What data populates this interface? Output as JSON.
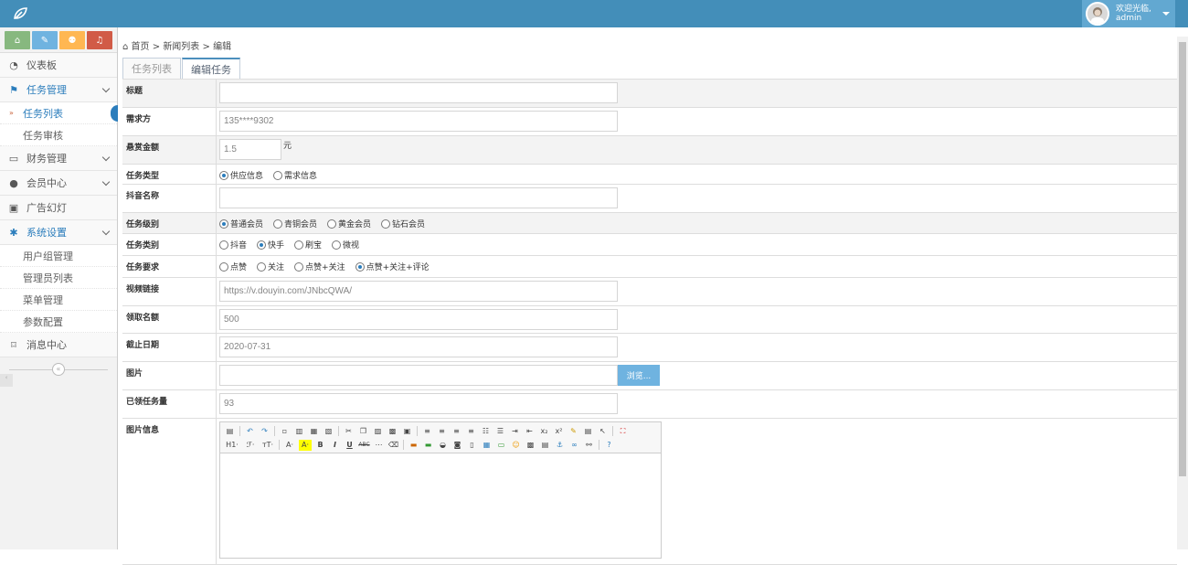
{
  "header": {
    "welcome": "欢迎光临,",
    "username": "admin"
  },
  "sidebar": {
    "items": [
      {
        "label": "仪表板",
        "icon": "dashboard-icon",
        "glyph": "◔"
      },
      {
        "label": "任务管理",
        "icon": "flag-icon",
        "glyph": "⚑",
        "open": true,
        "children": [
          "任务列表",
          "任务审核"
        ]
      },
      {
        "label": "财务管理",
        "icon": "inbox-icon",
        "glyph": "▭"
      },
      {
        "label": "会员中心",
        "icon": "user-icon",
        "glyph": "●"
      },
      {
        "label": "广告幻灯",
        "icon": "picture-icon",
        "glyph": "▣"
      },
      {
        "label": "系统设置",
        "icon": "gear-icon",
        "glyph": "✱",
        "open": true,
        "children": [
          "用户组管理",
          "管理员列表",
          "菜单管理",
          "参数配置"
        ]
      },
      {
        "label": "消息中心",
        "icon": "bookmark-icon",
        "glyph": "⌑"
      }
    ],
    "collapse": "«"
  },
  "breadcrumb": {
    "home": "首页",
    "list": "新闻列表",
    "current": "编辑",
    "sep": ">"
  },
  "tabs": {
    "list": "任务列表",
    "edit": "编辑任务"
  },
  "form": {
    "title_label": "标题",
    "title_value": "",
    "demand_label": "需求方",
    "demand_value": "135****9302",
    "reward_label": "悬赏金额",
    "reward_value": "1.5",
    "reward_unit": "元",
    "type_label": "任务类型",
    "type_options": [
      "供应信息",
      "需求信息"
    ],
    "douyin_label": "抖音名称",
    "douyin_value": "",
    "level_label": "任务级别",
    "level_options": [
      "普通会员",
      "青铜会员",
      "黄金会员",
      "钻石会员"
    ],
    "category_label": "任务类别",
    "category_options": [
      "抖音",
      "快手",
      "刷宝",
      "微视"
    ],
    "require_label": "任务要求",
    "require_options": [
      "点赞",
      "关注",
      "点赞+关注",
      "点赞+关注+评论"
    ],
    "video_label": "视频链接",
    "video_value": "https://v.douyin.com/JNbcQWA/",
    "quota_label": "领取名额",
    "quota_value": "500",
    "deadline_label": "截止日期",
    "deadline_value": "2020-07-31",
    "image_label": "图片",
    "browse": "浏览...",
    "received_label": "已领任务量",
    "received_value": "93",
    "info_label": "图片信息"
  },
  "editor": {
    "h1": "H1·",
    "font": "ℱ·",
    "size": "тT·",
    "color": "A·"
  }
}
